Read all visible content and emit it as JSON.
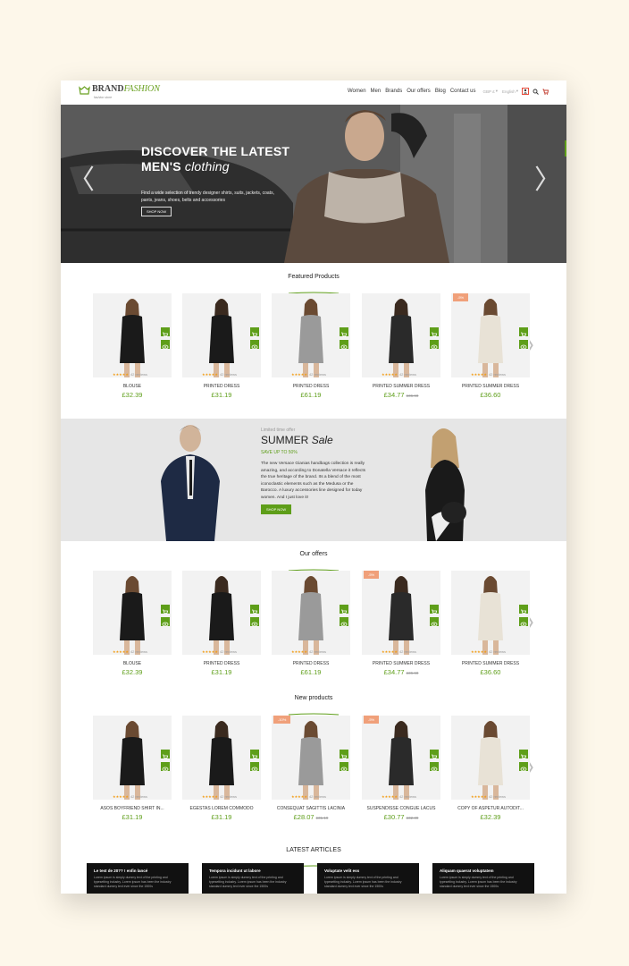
{
  "header": {
    "brand_a": "BRAND",
    "brand_b": "FASHION",
    "tagline": "fashion store",
    "nav": [
      "Women",
      "Men",
      "Brands",
      "Our offers",
      "Blog",
      "Contact us"
    ],
    "currency": "GBP £",
    "language": "English"
  },
  "hero": {
    "title_line1": "DISCOVER THE LATEST",
    "title_line2a": "MEN'S",
    "title_line2b": "clothing",
    "subtitle": "Find a wide selection of trendy designer shirts, suits, jackets, coats, pants, jeans, shoes, belts and accessories",
    "button": "SHOP NOW"
  },
  "featured": {
    "title": "Featured Products",
    "items": [
      {
        "name": "BLOUSE",
        "price": "£32.39",
        "old": "",
        "badge": "",
        "reviews": "42 reviews"
      },
      {
        "name": "PRINTED DRESS",
        "price": "£31.19",
        "old": "",
        "badge": "",
        "reviews": "42 reviews"
      },
      {
        "name": "PRINTED DRESS",
        "price": "£61.19",
        "old": "",
        "badge": "",
        "reviews": "42 reviews"
      },
      {
        "name": "PRINTED SUMMER DRESS",
        "price": "£34.77",
        "old": "£36.60",
        "badge": "",
        "reviews": "42 reviews"
      },
      {
        "name": "PRINTED SUMMER DRESS",
        "price": "£36.60",
        "old": "",
        "badge": "-5%",
        "reviews": "42 reviews"
      }
    ]
  },
  "summer": {
    "lto": "Limited time offer",
    "title_a": "SUMMER",
    "title_b": "Sale",
    "save": "SAVE UP TO 50%",
    "text": "The new Versace Gianias handbags collection is really amazing, and according to Donatella Versace it reflects the true heritage of the brand. Its a blend of the most iconoclastic elements such as the Medusa or the Barocco. A luxury accessories line designed for today women. And I just love it!",
    "button": "SHOP NOW"
  },
  "offers": {
    "title": "Our offers",
    "items": [
      {
        "name": "BLOUSE",
        "price": "£32.39",
        "old": "",
        "badge": "",
        "reviews": "42 reviews"
      },
      {
        "name": "PRINTED DRESS",
        "price": "£31.19",
        "old": "",
        "badge": "",
        "reviews": "42 reviews"
      },
      {
        "name": "PRINTED DRESS",
        "price": "£61.19",
        "old": "",
        "badge": "",
        "reviews": "42 reviews"
      },
      {
        "name": "PRINTED SUMMER DRESS",
        "price": "£34.77",
        "old": "£36.60",
        "badge": "-5%",
        "reviews": "42 reviews"
      },
      {
        "name": "PRINTED SUMMER DRESS",
        "price": "£36.60",
        "old": "",
        "badge": "",
        "reviews": "42 reviews"
      }
    ]
  },
  "newp": {
    "title": "New products",
    "items": [
      {
        "name": "ASOS BOYFRIEND SHIRT IN...",
        "price": "£31.19",
        "old": "",
        "badge": "",
        "reviews": "42 reviews"
      },
      {
        "name": "EGESTAS LOREM COMMODO",
        "price": "£31.19",
        "old": "",
        "badge": "",
        "reviews": "42 reviews"
      },
      {
        "name": "CONSEQUAT SAGITTIS LACINIA",
        "price": "£28.07",
        "old": "£31.19",
        "badge": "-10%",
        "reviews": "42 reviews"
      },
      {
        "name": "SUSPENDISSE CONGUE LACUS",
        "price": "£30.77",
        "old": "£32.39",
        "badge": "-5%",
        "reviews": "42 reviews"
      },
      {
        "name": "COPY OF ASPETUR AUTODIT...",
        "price": "£32.39",
        "old": "",
        "badge": "",
        "reviews": "42 reviews"
      }
    ]
  },
  "articles": {
    "title": "LATEST ARTICLES",
    "items": [
      {
        "title": "Le test de 20?? ! enfin lancé",
        "desc": "Lorem ipsum is simply dummy text of the printing and typesetting industry. Lorem ipsum has been the industry standard dummy text ever since the 1500s"
      },
      {
        "title": "Tempora incidunt ut labore",
        "desc": "Lorem ipsum is simply dummy text of the printing and typesetting industry. Lorem ipsum has been the industry standard dummy text ever since the 1500s"
      },
      {
        "title": "Voluptate velit ess",
        "desc": "Lorem ipsum is simply dummy text of the printing and typesetting industry. Lorem ipsum has been the industry standard dummy text ever since the 1500s"
      },
      {
        "title": "Aliquam quaerat voluptatem",
        "desc": "Lorem ipsum is simply dummy text of the printing and typesetting industry. Lorem ipsum has been the industry standard dummy text ever since the 1500s"
      }
    ]
  },
  "colors": {
    "accent": "#5e9e19",
    "badge": "#f0a07a",
    "price": "#5e9e19"
  }
}
